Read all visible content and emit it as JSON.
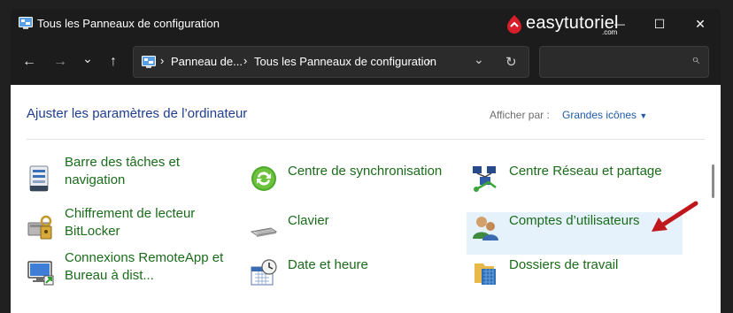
{
  "titlebar": {
    "title": "Tous les Panneaux de configuration",
    "brand": "easytutoriel",
    "brand_suffix": ".com",
    "minimize_glyph": "—",
    "maximize_glyph": "☐",
    "close_glyph": "✕"
  },
  "navbar": {
    "back_glyph": "←",
    "forward_glyph": "→",
    "recent_glyph": "⌄",
    "up_glyph": "↑",
    "breadcrumbs": [
      "Panneau de...",
      "Tous les Panneaux de configuration"
    ],
    "separator": "›",
    "dropdown_glyph": "⌄",
    "refresh_glyph": "↻",
    "search_placeholder": "",
    "search_glyph": "⌕"
  },
  "content": {
    "heading": "Ajuster les paramètres de l’ordinateur",
    "view_by_label": "Afficher par :",
    "view_by_value": "Grandes icônes",
    "items": [
      {
        "label_line1": "Barre des tâches et",
        "label_line2": "navigation",
        "icon": "taskbar-icon"
      },
      {
        "label_line1": "Centre de synchronisation",
        "label_line2": "",
        "icon": "sync-center-icon"
      },
      {
        "label_line1": "Centre Réseau et partage",
        "label_line2": "",
        "icon": "network-sharing-icon"
      },
      {
        "label_line1": "Chiffrement de lecteur",
        "label_line2": "BitLocker",
        "icon": "bitlocker-icon"
      },
      {
        "label_line1": "Clavier",
        "label_line2": "",
        "icon": "keyboard-icon"
      },
      {
        "label_line1": "Comptes d’utilisateurs",
        "label_line2": "",
        "icon": "user-accounts-icon"
      },
      {
        "label_line1": "Connexions RemoteApp et",
        "label_line2": "Bureau à dist...",
        "icon": "remoteapp-icon"
      },
      {
        "label_line1": "Date et heure",
        "label_line2": "",
        "icon": "date-time-icon"
      },
      {
        "label_line1": "Dossiers de travail",
        "label_line2": "",
        "icon": "work-folders-icon"
      }
    ]
  },
  "colors": {
    "accent": "#1e5aa8",
    "link_green": "#1a6b1a",
    "highlight": "#e5f1fb",
    "annotation_arrow": "#c0171c"
  }
}
